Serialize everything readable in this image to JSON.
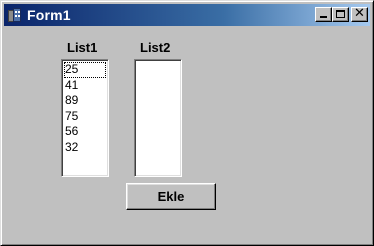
{
  "window": {
    "title": "Form1",
    "accent": "#0a246a",
    "face_color": "#c0c0c0",
    "icon": "app-building-icon",
    "caption_buttons": {
      "minimize_icon": "minimize-icon",
      "maximize_icon": "maximize-icon",
      "close_glyph": "✕"
    }
  },
  "list1": {
    "label": "List1",
    "items": [
      "25",
      "41",
      "89",
      "75",
      "56",
      "32"
    ],
    "focused_index": 0
  },
  "list2": {
    "label": "List2",
    "items": []
  },
  "add_button": {
    "label": "Ekle"
  }
}
